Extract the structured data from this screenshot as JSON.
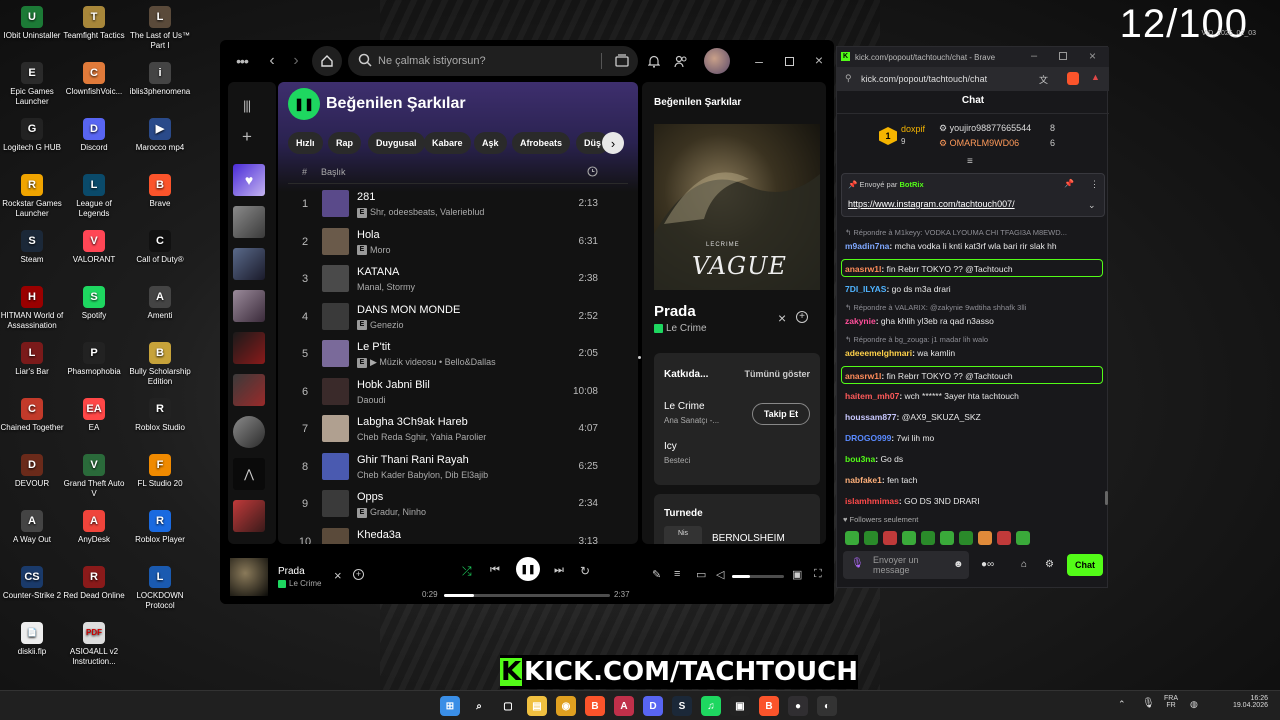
{
  "desktop": {
    "counter": "12/100",
    "counter_sub": "VID_2026_02_03",
    "icons": [
      {
        "label": "IObit Uninstaller",
        "color": "#1c7a36",
        "glyph": "U"
      },
      {
        "label": "Teamfight Tactics",
        "color": "#a8873a",
        "glyph": "T"
      },
      {
        "label": "The Last of Us™ Part I",
        "color": "#5a4a3a",
        "glyph": "L"
      },
      {
        "label": "Epic Games Launcher",
        "color": "#2a2a2a",
        "glyph": "E"
      },
      {
        "label": "ClownfishVoic...",
        "color": "#e07a3a",
        "glyph": "C"
      },
      {
        "label": "iblis3phenomena",
        "color": "#444",
        "glyph": "i"
      },
      {
        "label": "Logitech G HUB",
        "color": "#222",
        "glyph": "G"
      },
      {
        "label": "Discord",
        "color": "#5865f2",
        "glyph": "D"
      },
      {
        "label": "Marocco mp4",
        "color": "#2a4a8a",
        "glyph": "▶"
      },
      {
        "label": "Rockstar Games Launcher",
        "color": "#f0a400",
        "glyph": "R"
      },
      {
        "label": "League of Legends",
        "color": "#0a4a6a",
        "glyph": "L"
      },
      {
        "label": "Brave",
        "color": "#fb542b",
        "glyph": "B"
      },
      {
        "label": "Steam",
        "color": "#1b2838",
        "glyph": "S"
      },
      {
        "label": "VALORANT",
        "color": "#ff4655",
        "glyph": "V"
      },
      {
        "label": "Call of Duty®",
        "color": "#111",
        "glyph": "C"
      },
      {
        "label": "HITMAN World of Assassination",
        "color": "#9a0000",
        "glyph": "H"
      },
      {
        "label": "Spotify",
        "color": "#1ed760",
        "glyph": "S"
      },
      {
        "label": "Amenti",
        "color": "#444",
        "glyph": "A"
      },
      {
        "label": "Liar's Bar",
        "color": "#7a1a1a",
        "glyph": "L"
      },
      {
        "label": "Phasmophobia",
        "color": "#222",
        "glyph": "P"
      },
      {
        "label": "Bully Scholarship Edition",
        "color": "#c7a33a",
        "glyph": "B"
      },
      {
        "label": "Chained Together",
        "color": "#c23a2a",
        "glyph": "C"
      },
      {
        "label": "EA",
        "color": "#ff4747",
        "glyph": "EA"
      },
      {
        "label": "Roblox Studio",
        "color": "#222",
        "glyph": "R"
      },
      {
        "label": "DEVOUR",
        "color": "#6a2a1a",
        "glyph": "D"
      },
      {
        "label": "Grand Theft Auto V",
        "color": "#2a6a3a",
        "glyph": "V"
      },
      {
        "label": "FL Studio 20",
        "color": "#f08a00",
        "glyph": "F"
      },
      {
        "label": "A Way Out",
        "color": "#444",
        "glyph": "A"
      },
      {
        "label": "AnyDesk",
        "color": "#ef443b",
        "glyph": "A"
      },
      {
        "label": "Roblox Player",
        "color": "#1a6ae0",
        "glyph": "R"
      },
      {
        "label": "Counter-Strike 2",
        "color": "#1a3a6a",
        "glyph": "CS"
      },
      {
        "label": "Red Dead Online",
        "color": "#8a1a1a",
        "glyph": "R"
      },
      {
        "label": "LOCKDOWN Protocol",
        "color": "#1a5ab0",
        "glyph": "L"
      },
      {
        "label": "diskii.flp",
        "color": "#eee",
        "glyph": "📄"
      },
      {
        "label": "ASIO4ALL v2 Instruction...",
        "color": "#ddd",
        "glyph": "PDF"
      }
    ]
  },
  "spotify": {
    "search_placeholder": "Ne çalmak istiyorsun?",
    "playlist_title": "Beğenilen Şarkılar",
    "chips": [
      "Hızlı",
      "Rap",
      "Duygusal",
      "Kabare",
      "Aşk",
      "Afrobeats",
      "Düş"
    ],
    "col_number": "#",
    "col_title": "Başlık",
    "tracks": [
      {
        "n": "1",
        "title": "281",
        "artist": "Shr, odeesbeats, Valerieblud",
        "explicit": true,
        "duration": "2:13",
        "color": "#5a4a8a"
      },
      {
        "n": "2",
        "title": "Hola",
        "artist": "Moro",
        "explicit": true,
        "duration": "6:31",
        "color": "#6a5a4a"
      },
      {
        "n": "3",
        "title": "KATANA",
        "artist": "Manal, Stormy",
        "explicit": false,
        "duration": "2:38",
        "color": "#4a4a4a"
      },
      {
        "n": "4",
        "title": "DANS MON MONDE",
        "artist": "Genezio",
        "explicit": true,
        "duration": "2:52",
        "color": "#3a3a3a"
      },
      {
        "n": "5",
        "title": "Le P'tit",
        "artist": "▶ Müzik videosu • Bello&Dallas",
        "explicit": true,
        "duration": "2:05",
        "color": "#7a6a9a"
      },
      {
        "n": "6",
        "title": "Hobk Jabni Blil",
        "artist": "Daoudi",
        "explicit": false,
        "duration": "10:08",
        "color": "#3a2a2a"
      },
      {
        "n": "7",
        "title": "Labgha 3Ch9ak Hareb",
        "artist": "Cheb Reda Sghir, Yahia Parolier",
        "explicit": false,
        "duration": "4:07",
        "color": "#b0a090"
      },
      {
        "n": "8",
        "title": "Ghir Thani Rani Rayah",
        "artist": "Cheb Kader Babylon, Dib El3ajib",
        "explicit": false,
        "duration": "6:25",
        "color": "#4a5ab0"
      },
      {
        "n": "9",
        "title": "Opps",
        "artist": "Gradur, Ninho",
        "explicit": true,
        "duration": "2:34",
        "color": "#3a3a3a"
      },
      {
        "n": "10",
        "title": "Kheda3a",
        "artist": "",
        "explicit": false,
        "duration": "3:13",
        "color": "#5a4a3a"
      }
    ],
    "side": {
      "header": "Beğenilen Şarkılar",
      "cover_text": "VAGUE",
      "cover_small": "LECRIME",
      "track": "Prada",
      "artist": "Le Crime",
      "credits_title": "Katkıda...",
      "show_all": "Tümünü göster",
      "credit1_name": "Le Crime",
      "credit1_role": "Ana Sanatçı -...",
      "follow": "Takip Et",
      "credit2_name": "Icy",
      "credit2_role": "Besteci",
      "tour_title": "Turnede",
      "tour_item": "BERNOLSHEIM",
      "tour_date": "Nis"
    },
    "now": {
      "title": "Prada",
      "artist": "Le Crime",
      "elapsed": "0:29",
      "total": "2:37",
      "progress": 0.18,
      "volume": 0.35
    }
  },
  "kick": {
    "window_title": "kick.com/popout/tachtouch/chat - Brave",
    "url": "kick.com/popout/tachtouch/chat",
    "chat_header": "Chat",
    "leaderboard": {
      "top_name": "doxpif",
      "top_val": "9",
      "rank": "1",
      "second_name": "youjiro98877665544",
      "second_val": "8",
      "third_name": "OMARLM9WD06",
      "third_val": "6"
    },
    "pinned_by": "Envoyé par",
    "pinned_user": "BotRix",
    "pinned_link": "https://www.instagram.com/tachtouch007/",
    "messages": [
      {
        "type": "reply",
        "text": "↰ Répondre à M1keyy: VODKA LYOUMA CHI TFAGI3A M8EWD..."
      },
      {
        "type": "msg",
        "user": "m9adin7na",
        "ucolor": "#7fa8ff",
        "text": "mcha vodka li knti kat3rf wla bari rir slak hh"
      },
      {
        "type": "hl",
        "user": "anasrw1l",
        "ucolor": "#ff8c5a",
        "text": "fin Rebrr TOKYO ?? @Tachtouch"
      },
      {
        "type": "msg",
        "user": "7DI_ILYAS",
        "ucolor": "#4fb3ff",
        "text": "go ds m3a drari"
      },
      {
        "type": "reply",
        "text": "↰ Répondre à VALARIX: @zakynie 9wdtiha shhafk 3lli"
      },
      {
        "type": "msg",
        "user": "zakynie",
        "ucolor": "#ff4f9a",
        "text": "gha khlih yl3eb ra qad n3asso"
      },
      {
        "type": "reply",
        "text": "↰ Répondre à bg_zouga: j1 madar lih walo"
      },
      {
        "type": "msg",
        "user": "adeeemelghmari",
        "ucolor": "#ffd24a",
        "text": "wa kamlin"
      },
      {
        "type": "hl",
        "user": "anasrw1l",
        "ucolor": "#ff8c5a",
        "text": "fin Rebrr TOKYO ?? @Tachtouch"
      },
      {
        "type": "msg",
        "user": "haitem_mh07",
        "ucolor": "#ff5a5a",
        "text": "wch ****** 3ayer hta tachtouch"
      },
      {
        "type": "msg",
        "user": "houssam877",
        "ucolor": "#c8c8ff",
        "text": "@AX9_SKUZA_SKZ"
      },
      {
        "type": "msg",
        "user": "DROGO999",
        "ucolor": "#5a8aff",
        "text": "7wi lih mo"
      },
      {
        "type": "msg",
        "user": "bou3na",
        "ucolor": "#53fc18",
        "text": "Go ds"
      },
      {
        "type": "msg",
        "user": "nabfake1",
        "ucolor": "#ffb07a",
        "text": "fen tach"
      },
      {
        "type": "msg",
        "user": "islamhmimas",
        "ucolor": "#ff4a4a",
        "text": "GO DS 3ND DRARI"
      }
    ],
    "followers_only": "Followers seulement",
    "input_placeholder": "Envoyer un message",
    "send": "Chat"
  },
  "banner": "KICK.COM/TACHTOUCH",
  "taskbar": {
    "lang1": "FRA",
    "lang2": "FR",
    "time": "16:26",
    "date": "19.04.2026"
  },
  "colors": {
    "spotify_green": "#1ed760",
    "kick_green": "#53fc18"
  }
}
